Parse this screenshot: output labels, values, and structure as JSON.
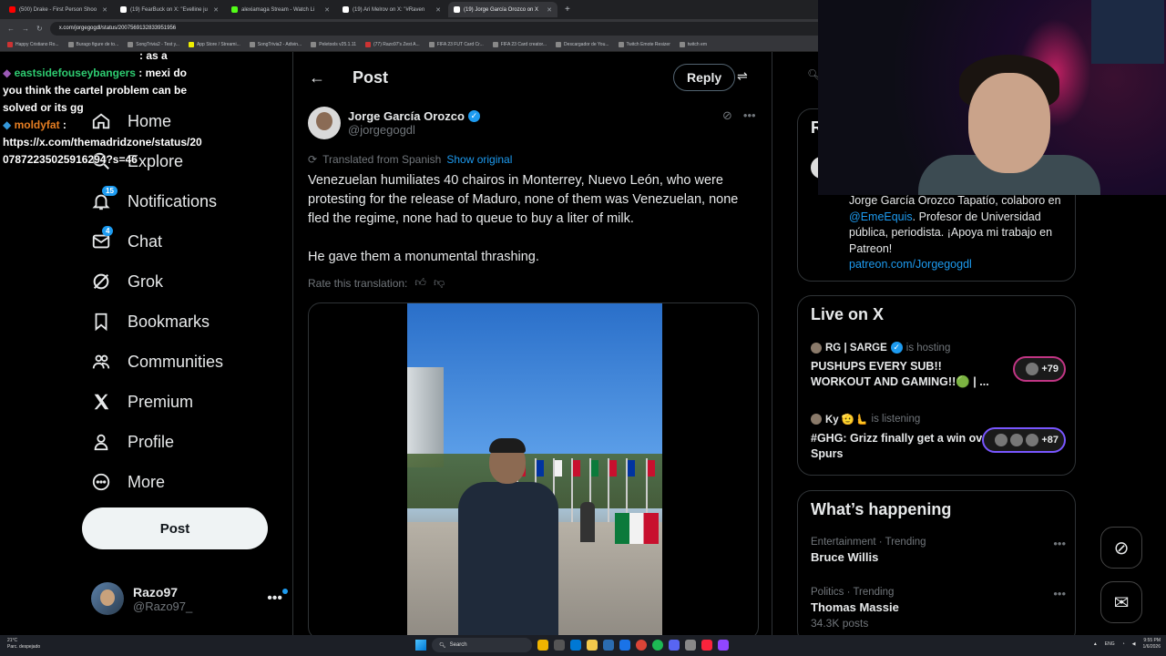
{
  "browser": {
    "tabs": [
      {
        "label": "(500) Drake - First Person Shoo",
        "color": "#ff0000",
        "active": false
      },
      {
        "label": "(19) FearBuck on X: \"Evelline ju",
        "color": "#ffffff",
        "active": false
      },
      {
        "label": "alexiamaga Stream - Watch Li",
        "color": "#53fc18",
        "active": false
      },
      {
        "label": "(19) Ari Melrov on X: \"#Raven",
        "color": "#ffffff",
        "active": false
      },
      {
        "label": "(19) Jorge García Orozco on X",
        "color": "#ffffff",
        "active": true
      }
    ],
    "url": "x.com/jorgegogdl/status/2007569132833951956",
    "bookmarks": [
      "Happy Cristiano Ro...",
      "Burago figure de to...",
      "SongTrivia2 - Test y...",
      "App Store / Streami...",
      "SongTrivia2 - Adivin...",
      "Peletools v25.1.11",
      "(77) Razo97's Zest A...",
      "FIFA 23 FUT Card Cr...",
      "FIFA 23 Card creator...",
      "Descargador de You...",
      "Twitch Emote Resizer",
      "twitch em"
    ]
  },
  "chat": {
    "partial_line": "as a",
    "msg1_user": "eastsidefouseybangers",
    "msg1_text": "mexi do you think the cartel problem can be solved or its gg",
    "msg2_user": "moldyfat",
    "msg2_text": "https://x.com/themadridzone/status/2007872235025916294?s=46"
  },
  "nav": {
    "home": "Home",
    "explore": "Explore",
    "notifications": "Notifications",
    "notifications_badge": "15",
    "chat": "Chat",
    "chat_badge": "4",
    "grok": "Grok",
    "bookmarks": "Bookmarks",
    "communities": "Communities",
    "premium": "Premium",
    "profile": "Profile",
    "more": "More",
    "post_button": "Post"
  },
  "account": {
    "name": "Razo97",
    "handle": "@Razo97_"
  },
  "main": {
    "title": "Post",
    "reply_button": "Reply",
    "author_name": "Jorge García Orozco",
    "author_handle": "@jorgegogdl",
    "translated_label": "Translated from Spanish",
    "show_original": "Show original",
    "paragraph1": "Venezuelan humiliates 40 chairos in Monterrey, Nuevo León, who were protesting for the release of Maduro, none of them was Venezuelan, none fled the regime, none had to queue to buy a liter of milk.",
    "paragraph2": "He gave them a monumental thrashing.",
    "rate_translation": "Rate this translation:"
  },
  "right": {
    "profile_card_letter": "R",
    "bio_part1": "Jorge García Orozco Tapatío, colaboro en ",
    "bio_mention": "@EmeEquis",
    "bio_part2": ". Profesor de Universidad pública, periodista. ¡Apoya mi trabajo en Patreon!",
    "bio_link": "patreon.com/Jorgegogdl",
    "live_title": "Live on X",
    "live": [
      {
        "host": "RG | SARGE",
        "status": "is hosting",
        "title": "PUSHUPS EVERY SUB!! WORKOUT AND GAMING!!🟢 | ...",
        "count": "+79"
      },
      {
        "host": "Ky 🫡🫷",
        "status": "is listening",
        "title": "#GHG: Grizz finally get a win over Spurs",
        "count": "+87"
      }
    ],
    "happening_title": "What’s happening",
    "trends": [
      {
        "category": "Entertainment · Trending",
        "name": "Bruce Willis",
        "count": ""
      },
      {
        "category": "Politics · Trending",
        "name": "Thomas Massie",
        "count": "34.3K posts"
      }
    ]
  },
  "taskbar": {
    "weather_temp": "21°C",
    "weather_desc": "Parc. despejado",
    "search": "Search",
    "lang": "ENG",
    "time": "9:55 PM",
    "date": "1/6/2026"
  }
}
